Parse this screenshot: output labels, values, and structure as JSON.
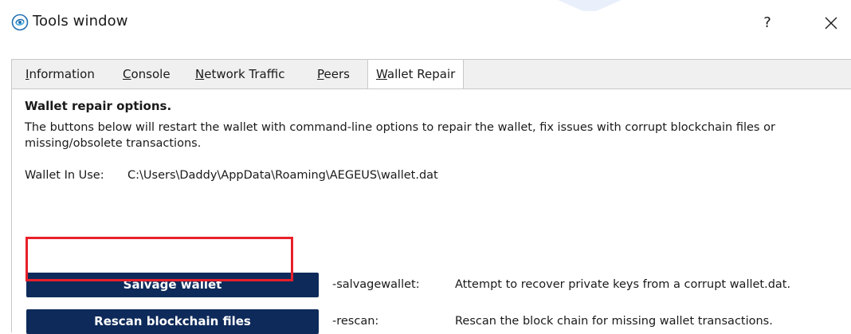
{
  "window": {
    "title": "Tools window",
    "help_label": "?"
  },
  "tabs": [
    {
      "label": "Information",
      "accel": "I",
      "rest": "nformation"
    },
    {
      "label": "Console",
      "accel": "C",
      "rest": "onsole"
    },
    {
      "label": "Network Traffic",
      "accel": "N",
      "rest": "etwork Traffic"
    },
    {
      "label": "Peers",
      "accel": "P",
      "rest": "eers"
    },
    {
      "label": "Wallet Repair",
      "accel": "W",
      "rest": "allet Repair"
    }
  ],
  "repair": {
    "heading": "Wallet repair options.",
    "description": "The buttons below will restart the wallet with command-line options to repair the wallet, fix issues with corrupt blockchain files or missing/obsolete transactions.",
    "wallet_in_use_label": "Wallet In Use:",
    "wallet_path": "C:\\Users\\Daddy\\AppData\\Roaming\\AEGEUS\\wallet.dat",
    "actions": [
      {
        "button": "Salvage wallet",
        "option": "-salvagewallet:",
        "description": "Attempt to recover private keys from a corrupt wallet.dat."
      },
      {
        "button": "Rescan blockchain files",
        "option": "-rescan:",
        "description": "Rescan the block chain for missing wallet transactions."
      }
    ]
  },
  "colors": {
    "button_bg": "#0e2a5a",
    "highlight": "#e8202a"
  }
}
